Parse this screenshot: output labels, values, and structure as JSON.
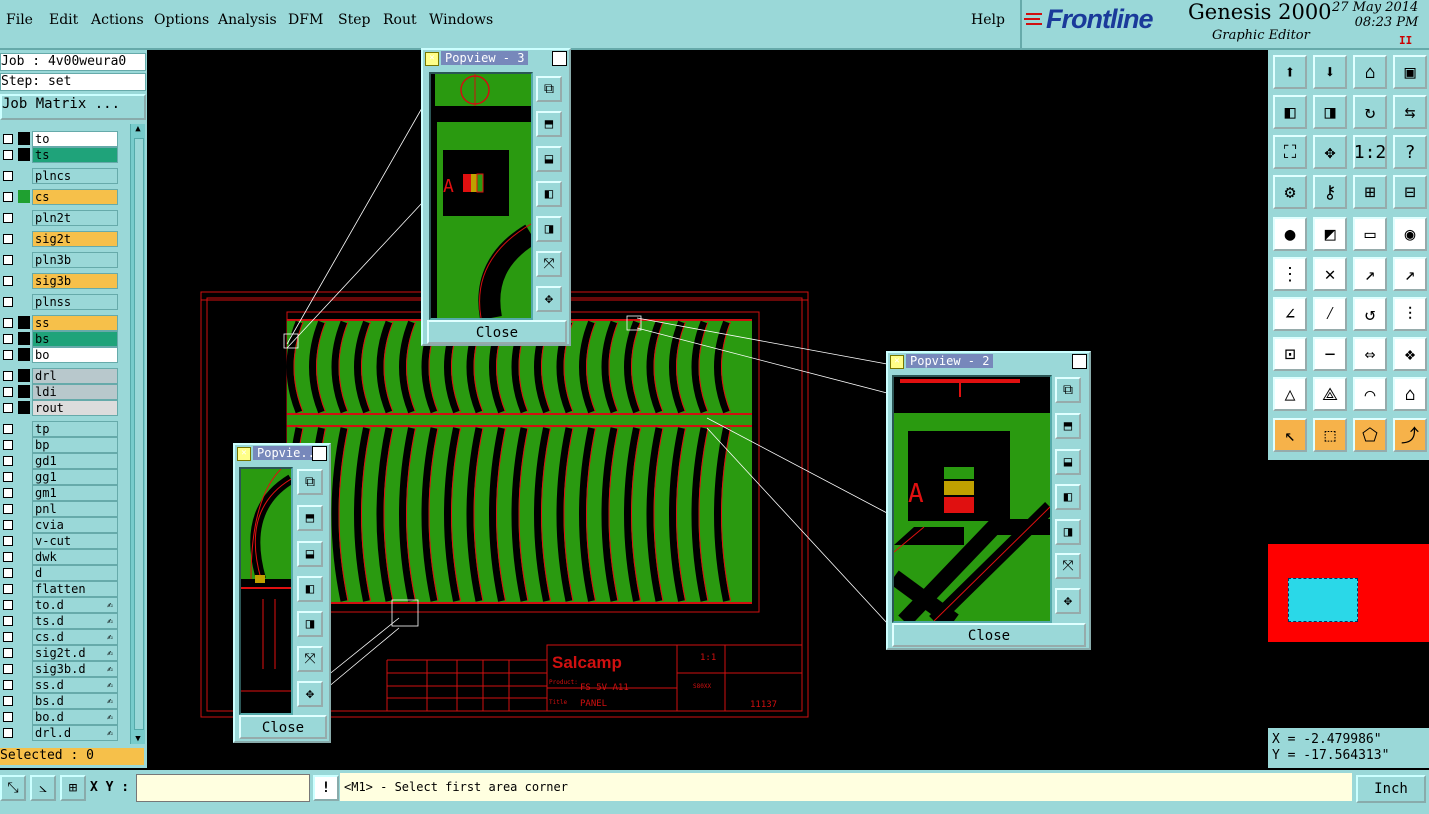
{
  "menubar": {
    "items": [
      "File",
      "Edit",
      "Actions",
      "Options",
      "Analysis",
      "DFM",
      "Step",
      "Rout",
      "Windows"
    ],
    "help": "Help"
  },
  "brand": {
    "logo": "Frontline",
    "product": "Genesis 2000",
    "subtitle": "Graphic Editor",
    "date": "27 May 2014",
    "time": "08:23 PM",
    "pause": "II"
  },
  "left_panel": {
    "job": "Job : 4v00weura0",
    "step": "Step: set",
    "job_matrix": "Job Matrix ...",
    "layers": [
      {
        "name": "to",
        "color": "#ffffff",
        "sq": "#000000",
        "lock": ""
      },
      {
        "name": "ts",
        "color": "#1fa37a",
        "sq": "#000000",
        "lock": ""
      },
      {
        "name": "plncs",
        "color": "#9ad8d8",
        "sq": "#9ad8d8",
        "lock": ""
      },
      {
        "name": "cs",
        "color": "#f6c04a",
        "sq": "#1fa030",
        "lock": ""
      },
      {
        "name": "pln2t",
        "color": "#9ad8d8",
        "sq": "#9ad8d8",
        "lock": ""
      },
      {
        "name": "sig2t",
        "color": "#f6c04a",
        "sq": "#9ad8d8",
        "lock": ""
      },
      {
        "name": "pln3b",
        "color": "#9ad8d8",
        "sq": "#9ad8d8",
        "lock": ""
      },
      {
        "name": "sig3b",
        "color": "#f6c04a",
        "sq": "#9ad8d8",
        "lock": ""
      },
      {
        "name": "plnss",
        "color": "#9ad8d8",
        "sq": "#9ad8d8",
        "lock": ""
      },
      {
        "name": "ss",
        "color": "#f6c04a",
        "sq": "#000000",
        "lock": ""
      },
      {
        "name": "bs",
        "color": "#1fa37a",
        "sq": "#000000",
        "lock": ""
      },
      {
        "name": "bo",
        "color": "#ffffff",
        "sq": "#000000",
        "lock": ""
      },
      {
        "name": "drl",
        "color": "#b8c8cc",
        "sq": "#000000",
        "lock": ""
      },
      {
        "name": "ldi",
        "color": "#b8c8cc",
        "sq": "#000000",
        "lock": ""
      },
      {
        "name": "rout",
        "color": "#dcdcdc",
        "sq": "#000000",
        "lock": ""
      },
      {
        "name": "tp",
        "color": "#9ad8d8",
        "sq": "#9ad8d8",
        "lock": ""
      },
      {
        "name": "bp",
        "color": "#9ad8d8",
        "sq": "#9ad8d8",
        "lock": ""
      },
      {
        "name": "gd1",
        "color": "#9ad8d8",
        "sq": "#9ad8d8",
        "lock": ""
      },
      {
        "name": "gg1",
        "color": "#9ad8d8",
        "sq": "#9ad8d8",
        "lock": ""
      },
      {
        "name": "gm1",
        "color": "#9ad8d8",
        "sq": "#9ad8d8",
        "lock": ""
      },
      {
        "name": "pnl",
        "color": "#9ad8d8",
        "sq": "#9ad8d8",
        "lock": ""
      },
      {
        "name": "cvia",
        "color": "#9ad8d8",
        "sq": "#9ad8d8",
        "lock": ""
      },
      {
        "name": "v-cut",
        "color": "#9ad8d8",
        "sq": "#9ad8d8",
        "lock": ""
      },
      {
        "name": "dwk",
        "color": "#9ad8d8",
        "sq": "#9ad8d8",
        "lock": ""
      },
      {
        "name": "d",
        "color": "#9ad8d8",
        "sq": "#9ad8d8",
        "lock": ""
      },
      {
        "name": "flatten",
        "color": "#9ad8d8",
        "sq": "#9ad8d8",
        "lock": ""
      },
      {
        "name": "to.d",
        "color": "#9ad8d8",
        "sq": "#9ad8d8",
        "lock": "✍"
      },
      {
        "name": "ts.d",
        "color": "#9ad8d8",
        "sq": "#9ad8d8",
        "lock": "✍"
      },
      {
        "name": "cs.d",
        "color": "#9ad8d8",
        "sq": "#9ad8d8",
        "lock": "✍"
      },
      {
        "name": "sig2t.d",
        "color": "#9ad8d8",
        "sq": "#9ad8d8",
        "lock": "✍"
      },
      {
        "name": "sig3b.d",
        "color": "#9ad8d8",
        "sq": "#9ad8d8",
        "lock": "✍"
      },
      {
        "name": "ss.d",
        "color": "#9ad8d8",
        "sq": "#9ad8d8",
        "lock": "✍"
      },
      {
        "name": "bs.d",
        "color": "#9ad8d8",
        "sq": "#9ad8d8",
        "lock": "✍"
      },
      {
        "name": "bo.d",
        "color": "#9ad8d8",
        "sq": "#9ad8d8",
        "lock": "✍"
      },
      {
        "name": "drl.d",
        "color": "#9ad8d8",
        "sq": "#9ad8d8",
        "lock": "✍"
      }
    ],
    "selected": "Selected : 0"
  },
  "bottom_bar": {
    "xy_label": "X Y :",
    "xy_value": "",
    "warn": "!",
    "message": "<M1> - Select first area corner",
    "unit": "Inch"
  },
  "coords": {
    "x": "X = -2.479986\"",
    "y": "Y = -17.564313\""
  },
  "popviews": {
    "p3": {
      "title": "Popview - 3",
      "close": "Close"
    },
    "p2": {
      "title": "Popview - 2",
      "close": "Close"
    },
    "p1": {
      "title": "Popvie...",
      "close": "Close"
    }
  },
  "drawing": {
    "company": "Salcamp",
    "product_label": "Product:",
    "title_label": "Title",
    "product": "FS 5V A11",
    "title": "PANEL",
    "scale": "1:1",
    "drawing_no": "11137",
    "size": "S80XX",
    "zoom_label_a": "A"
  },
  "colors": {
    "panel_bg": "#9ad8d8",
    "board_green": "#2a9a10",
    "trace_red": "#e01010",
    "accent_orange": "#f6b24a"
  }
}
